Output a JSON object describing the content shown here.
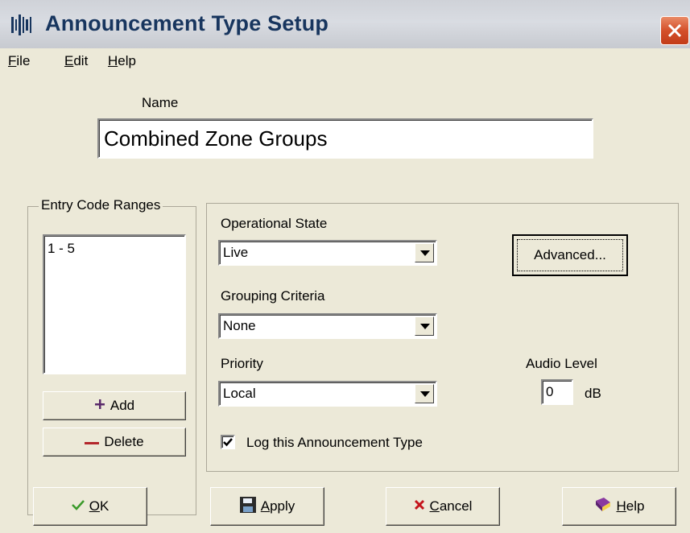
{
  "window": {
    "title": "Announcement Type Setup",
    "app_icon": "sound-bars-icon",
    "close_icon": "close-icon"
  },
  "menu": [
    {
      "label": "File",
      "mnemonic": "F",
      "rest": "ile"
    },
    {
      "label": "Edit",
      "mnemonic": "E",
      "rest": "dit"
    },
    {
      "label": "Help",
      "mnemonic": "H",
      "rest": "elp"
    }
  ],
  "name": {
    "label": "Name",
    "value": "Combined Zone Groups"
  },
  "entry_codes": {
    "label": "Entry Code Ranges",
    "items": [
      "1 - 5"
    ],
    "add_label": "Add",
    "delete_label": "Delete"
  },
  "operational_state": {
    "label": "Operational State",
    "value": "Live"
  },
  "grouping_criteria": {
    "label": "Grouping Criteria",
    "value": "None"
  },
  "priority": {
    "label": "Priority",
    "value": "Local"
  },
  "advanced": {
    "label": "Advanced..."
  },
  "audio_level": {
    "label": "Audio Level",
    "value": "0",
    "unit": "dB"
  },
  "log": {
    "label": "Log this Announcement Type",
    "checked": true
  },
  "buttons": {
    "ok": {
      "mnemonic": "O",
      "rest": "K"
    },
    "apply": {
      "mnemonic": "A",
      "rest": "pply"
    },
    "cancel": {
      "mnemonic": "C",
      "rest": "ancel"
    },
    "help": {
      "mnemonic": "H",
      "rest": "elp"
    }
  },
  "colors": {
    "title_text": "#17355e",
    "plus_icon": "#5a2a6a",
    "minus_icon": "#b3262b",
    "check_icon": "#3a9a2a",
    "cancel_icon": "#c4151c"
  }
}
